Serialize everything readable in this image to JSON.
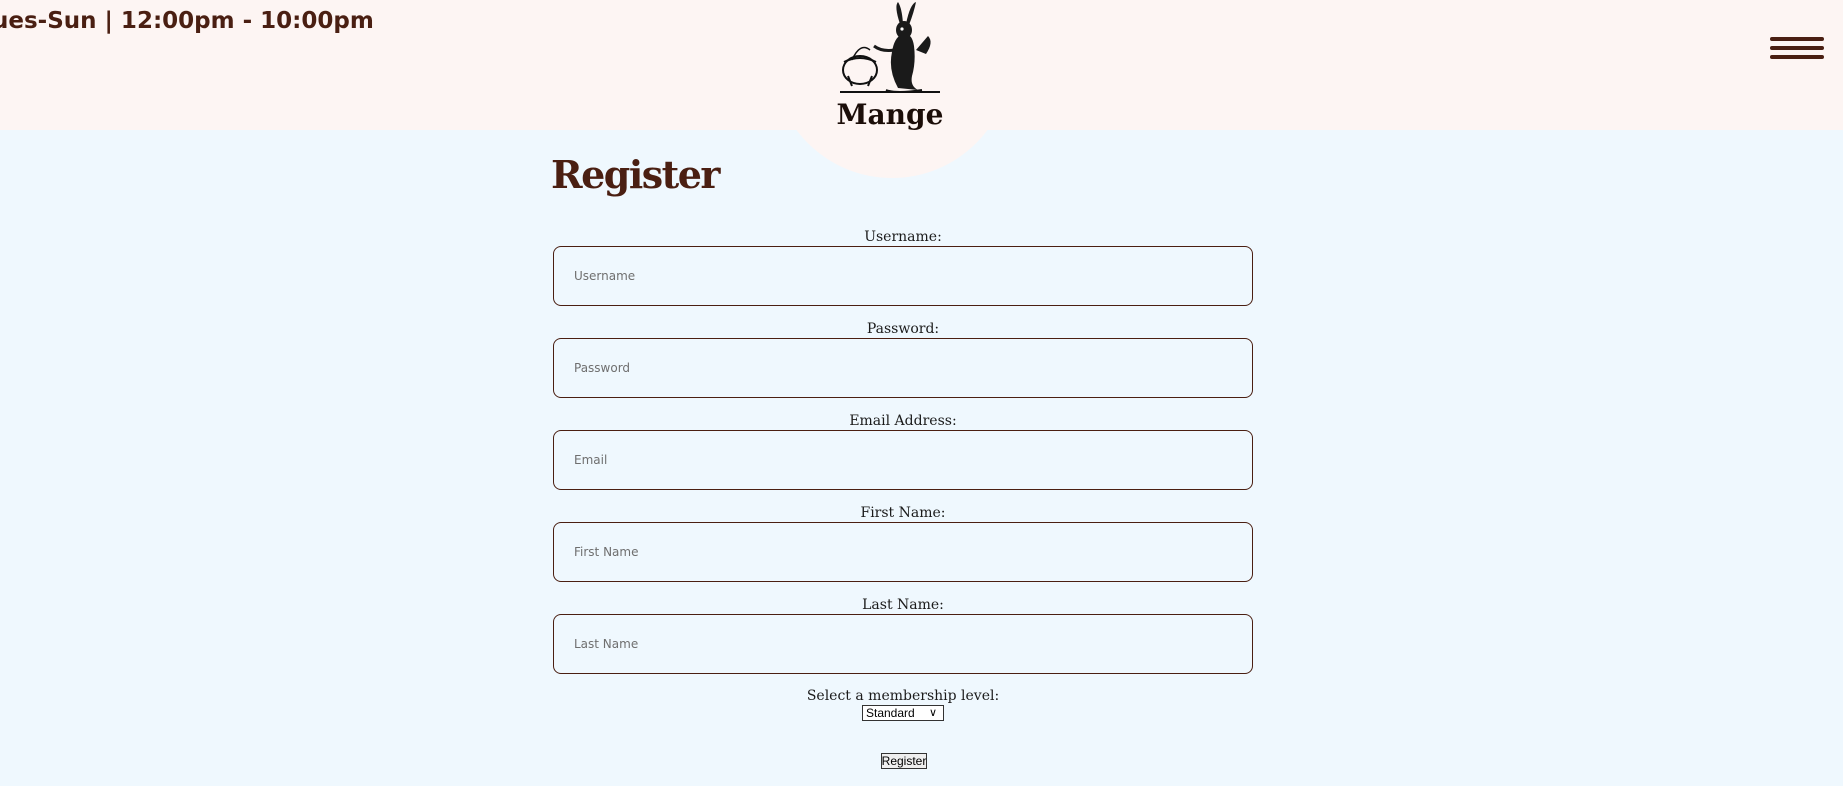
{
  "header": {
    "hours": "ues-Sun | 12:00pm - 10:00pm",
    "logo_text": "Mange",
    "menu_icon": "hamburger-menu-icon"
  },
  "form": {
    "title": "Register",
    "fields": [
      {
        "label": "Username:",
        "placeholder": "Username",
        "value": ""
      },
      {
        "label": "Password:",
        "placeholder": "Password",
        "value": ""
      },
      {
        "label": "Email Address:",
        "placeholder": "Email",
        "value": ""
      },
      {
        "label": "First Name:",
        "placeholder": "First Name",
        "value": ""
      },
      {
        "label": "Last Name:",
        "placeholder": "Last Name",
        "value": ""
      }
    ],
    "membership": {
      "label": "Select a membership level:",
      "selected": "Standard"
    },
    "submit_label": "Register"
  },
  "colors": {
    "header_bg": "#fdf5f3",
    "page_bg": "#eff8fe",
    "brand_brown": "#4a1f12"
  }
}
